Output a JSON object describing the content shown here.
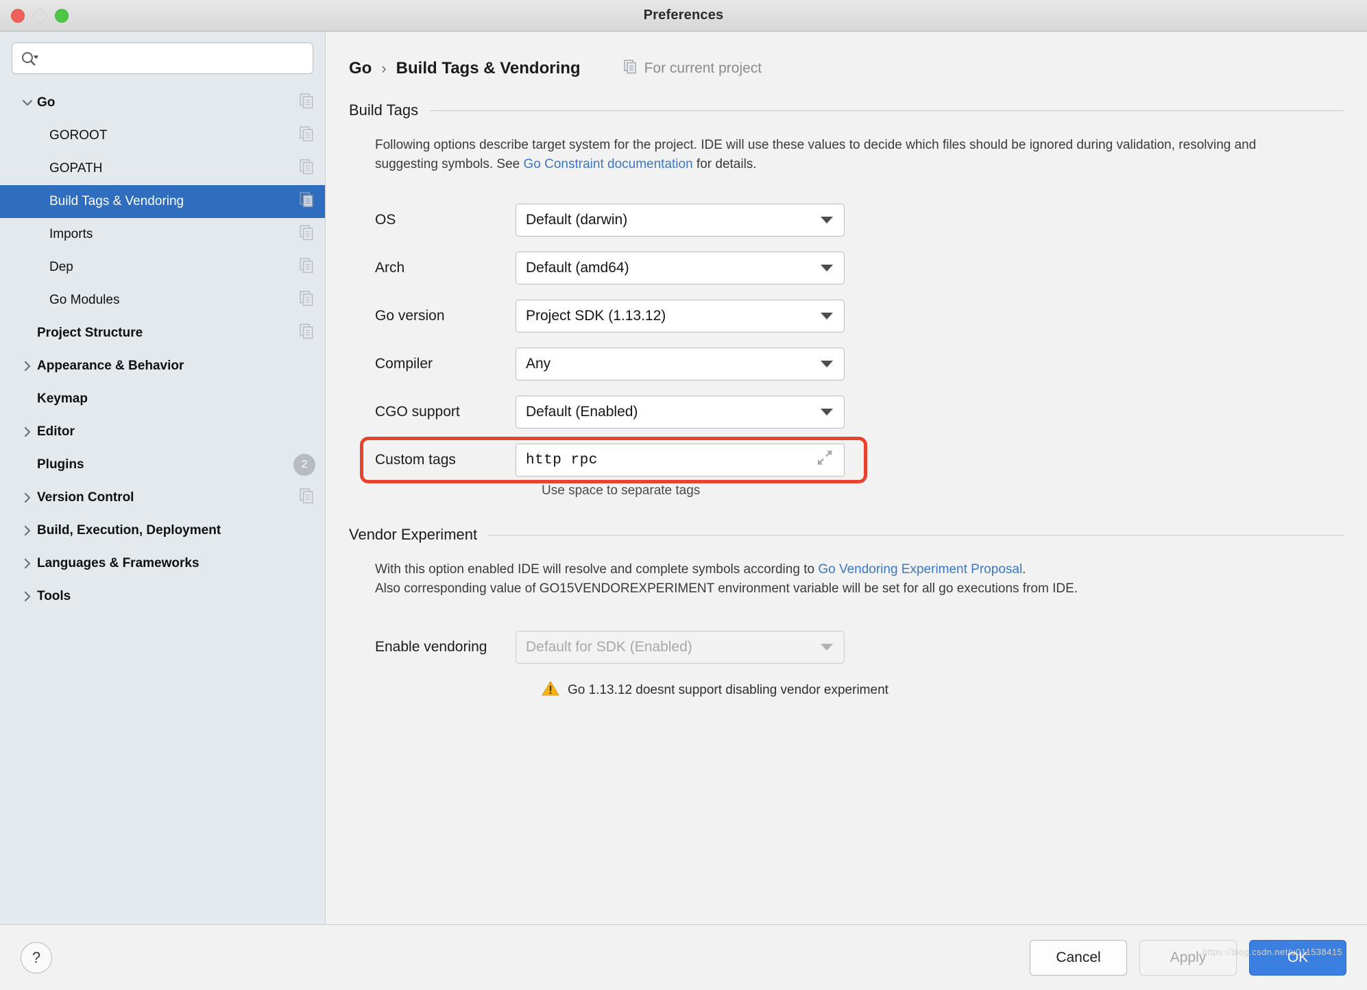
{
  "window": {
    "title": "Preferences"
  },
  "search": {
    "value": "",
    "placeholder": ""
  },
  "sidebar": {
    "items": [
      {
        "label": "Go",
        "level": 0,
        "bold": true,
        "arrow": "chevron-down",
        "copy": true,
        "selected": false,
        "badge": ""
      },
      {
        "label": "GOROOT",
        "level": 1,
        "bold": false,
        "arrow": "",
        "copy": true,
        "selected": false,
        "badge": ""
      },
      {
        "label": "GOPATH",
        "level": 1,
        "bold": false,
        "arrow": "",
        "copy": true,
        "selected": false,
        "badge": ""
      },
      {
        "label": "Build Tags & Vendoring",
        "level": 1,
        "bold": false,
        "arrow": "",
        "copy": true,
        "selected": true,
        "badge": ""
      },
      {
        "label": "Imports",
        "level": 1,
        "bold": false,
        "arrow": "",
        "copy": true,
        "selected": false,
        "badge": ""
      },
      {
        "label": "Dep",
        "level": 1,
        "bold": false,
        "arrow": "",
        "copy": true,
        "selected": false,
        "badge": ""
      },
      {
        "label": "Go Modules",
        "level": 1,
        "bold": false,
        "arrow": "",
        "copy": true,
        "selected": false,
        "badge": ""
      },
      {
        "label": "Project Structure",
        "level": 0,
        "bold": true,
        "arrow": "",
        "copy": true,
        "selected": false,
        "badge": ""
      },
      {
        "label": "Appearance & Behavior",
        "level": 0,
        "bold": true,
        "arrow": "chevron-right",
        "copy": false,
        "selected": false,
        "badge": ""
      },
      {
        "label": "Keymap",
        "level": 0,
        "bold": true,
        "arrow": "",
        "copy": false,
        "selected": false,
        "badge": ""
      },
      {
        "label": "Editor",
        "level": 0,
        "bold": true,
        "arrow": "chevron-right",
        "copy": false,
        "selected": false,
        "badge": ""
      },
      {
        "label": "Plugins",
        "level": 0,
        "bold": true,
        "arrow": "",
        "copy": false,
        "selected": false,
        "badge": "2"
      },
      {
        "label": "Version Control",
        "level": 0,
        "bold": true,
        "arrow": "chevron-right",
        "copy": true,
        "selected": false,
        "badge": ""
      },
      {
        "label": "Build, Execution, Deployment",
        "level": 0,
        "bold": true,
        "arrow": "chevron-right",
        "copy": false,
        "selected": false,
        "badge": ""
      },
      {
        "label": "Languages & Frameworks",
        "level": 0,
        "bold": true,
        "arrow": "chevron-right",
        "copy": false,
        "selected": false,
        "badge": ""
      },
      {
        "label": "Tools",
        "level": 0,
        "bold": true,
        "arrow": "chevron-right",
        "copy": false,
        "selected": false,
        "badge": ""
      }
    ]
  },
  "header": {
    "crumb_root": "Go",
    "crumb_sep": "›",
    "crumb_leaf": "Build Tags & Vendoring",
    "scope_label": "For current project"
  },
  "build_tags": {
    "section_title": "Build Tags",
    "desc_part1": "Following options describe target system for the project. IDE will use these values to decide which files should be ignored during validation, resolving and suggesting symbols. See ",
    "desc_link": "Go Constraint documentation",
    "desc_part2": " for details.",
    "fields": [
      {
        "label": "OS",
        "value": "Default (darwin)"
      },
      {
        "label": "Arch",
        "value": "Default (amd64)"
      },
      {
        "label": "Go version",
        "value": "Project SDK (1.13.12)"
      },
      {
        "label": "Compiler",
        "value": "Any"
      },
      {
        "label": "CGO support",
        "value": "Default (Enabled)"
      }
    ],
    "custom_tags_label": "Custom tags",
    "custom_tags_value": "http rpc",
    "custom_tags_hint": "Use space to separate tags",
    "highlight_color": "#e8432a"
  },
  "vendor": {
    "section_title": "Vendor Experiment",
    "desc_line1_part1": "With this option enabled IDE will resolve and complete symbols according to ",
    "desc_line1_link": "Go Vendoring Experiment Proposal",
    "desc_line1_part2": ".",
    "desc_line2": "Also corresponding value of GO15VENDOREXPERIMENT environment variable will be set for all go executions from IDE.",
    "enable_label": "Enable vendoring",
    "enable_value": "Default for SDK (Enabled)",
    "warning": "Go 1.13.12 doesnt support disabling vendor experiment"
  },
  "footer": {
    "help": "?",
    "cancel": "Cancel",
    "apply": "Apply",
    "ok": "OK"
  },
  "watermark": "https://blog.csdn.net/u011538415"
}
